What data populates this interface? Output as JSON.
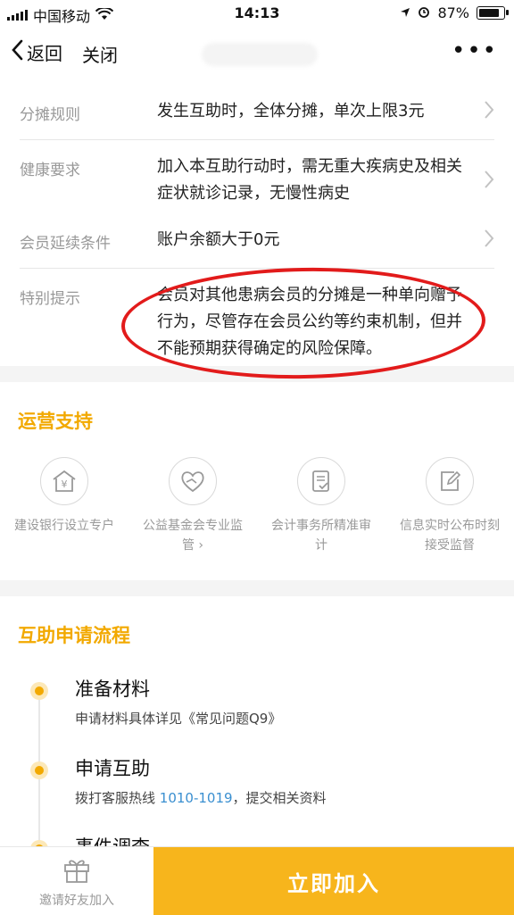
{
  "status_bar": {
    "carrier": "中国移动",
    "time": "14:13",
    "battery": "87%",
    "battery_level": 0.87
  },
  "nav": {
    "back_label": "返回",
    "close_label": "关闭",
    "more_label": "•••"
  },
  "info_rows": [
    {
      "label": "分摊规则",
      "value": "发生互助时，全体分摊，单次上限3元",
      "has_chevron": true
    },
    {
      "label": "健康要求",
      "value": "加入本互助行动时，需无重大疾病史及相关症状就诊记录，无慢性病史",
      "has_chevron": true
    },
    {
      "label": "会员延续条件",
      "value": "账户余额大于0元",
      "has_chevron": true
    },
    {
      "label": "特别提示",
      "value": "会员对其他患病会员的分摊是一种单向赠予行为，尽管存在会员公约等约束机制，但并不能预期获得确定的风险保障。",
      "has_chevron": false
    }
  ],
  "support": {
    "title": "运营支持",
    "items": [
      {
        "icon": "bank-icon",
        "text": "建设银行设立专户"
      },
      {
        "icon": "heart-hands-icon",
        "text": "公益基金会专业监管 ›"
      },
      {
        "icon": "audit-document-icon",
        "text": "会计事务所精准审计"
      },
      {
        "icon": "edit-document-icon",
        "text": "信息实时公布时刻接受监督"
      }
    ]
  },
  "process": {
    "title": "互助申请流程",
    "steps": [
      {
        "title": "准备材料",
        "desc": "申请材料具体详见《常见问题Q9》"
      },
      {
        "title": "申请互助",
        "desc_prefix": "拨打客服热线 ",
        "hotline": "1010-1019",
        "desc_suffix": "，提交相关资料"
      },
      {
        "title": "事件调查",
        "desc": ""
      }
    ]
  },
  "bottom": {
    "invite_label": "邀请好友加入",
    "join_label": "立即加入"
  },
  "colors": {
    "accent": "#f2a900",
    "join_button": "#f7b51c",
    "annotation": "#e21b1b",
    "link": "#3a8fd0"
  }
}
